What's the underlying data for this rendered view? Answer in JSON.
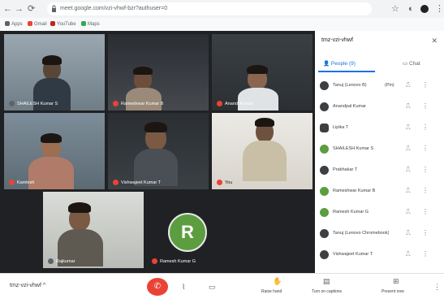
{
  "browser": {
    "url": "meet.google.com/vzi-vhwf-bzr?authuser=0",
    "bookmarks": [
      "Apps",
      "Gmail",
      "YouTube",
      "Maps"
    ]
  },
  "tiles": [
    {
      "name": "SHAILESH Kumar S",
      "kind": "video"
    },
    {
      "name": "Rameshwar Kumar B",
      "kind": "video"
    },
    {
      "name": "Anandi Kumar",
      "kind": "video"
    },
    {
      "name": "Kamlesh",
      "kind": "video"
    },
    {
      "name": "Vishwajeet Kumar T",
      "kind": "video"
    },
    {
      "name": "You",
      "kind": "video"
    },
    {
      "name": "Rajkumar",
      "kind": "video"
    },
    {
      "name": "R",
      "kind": "avatar",
      "color": "#5c9d3f",
      "label": "Ramesh Kumar G"
    }
  ],
  "panel": {
    "title": "tmz-vzi-vhwf",
    "tabs": [
      {
        "label": "People (9)"
      },
      {
        "label": "Chat"
      }
    ],
    "people": [
      {
        "name": "Tanuj (Lenovo B)",
        "extra": "(Pin)",
        "color": "#3c4043"
      },
      {
        "name": "Anandpal Kumar",
        "color": "#3c4043"
      },
      {
        "name": "Lipika T",
        "color": "#3c4043"
      },
      {
        "name": "SHAILESH Kumar S",
        "color": "#5c9d3f"
      },
      {
        "name": "Prabhakar T",
        "color": "#3c4043"
      },
      {
        "name": "Rameshwar Kumar B",
        "color": "#5c9d3f"
      },
      {
        "name": "Ramesh Kumar G",
        "color": "#5c9d3f"
      },
      {
        "name": "Tanuj (Lenovo Chromebook)",
        "color": "#3c4043"
      },
      {
        "name": "Vishwajeet Kumar T",
        "color": "#3c4043"
      }
    ]
  },
  "controls": {
    "meeting_code": "tmz-vzi-vhwf",
    "raise_hand": "Raise hand",
    "captions": "Turn on captions",
    "present": "Present now"
  },
  "icons": {
    "back": "←",
    "forward": "→",
    "reload": "⟳",
    "star": "☆",
    "menu": "⋮",
    "close": "✕",
    "mic": "🎤",
    "more": "⋮",
    "hangup": "✆",
    "people": "👥",
    "chat": "💬"
  }
}
